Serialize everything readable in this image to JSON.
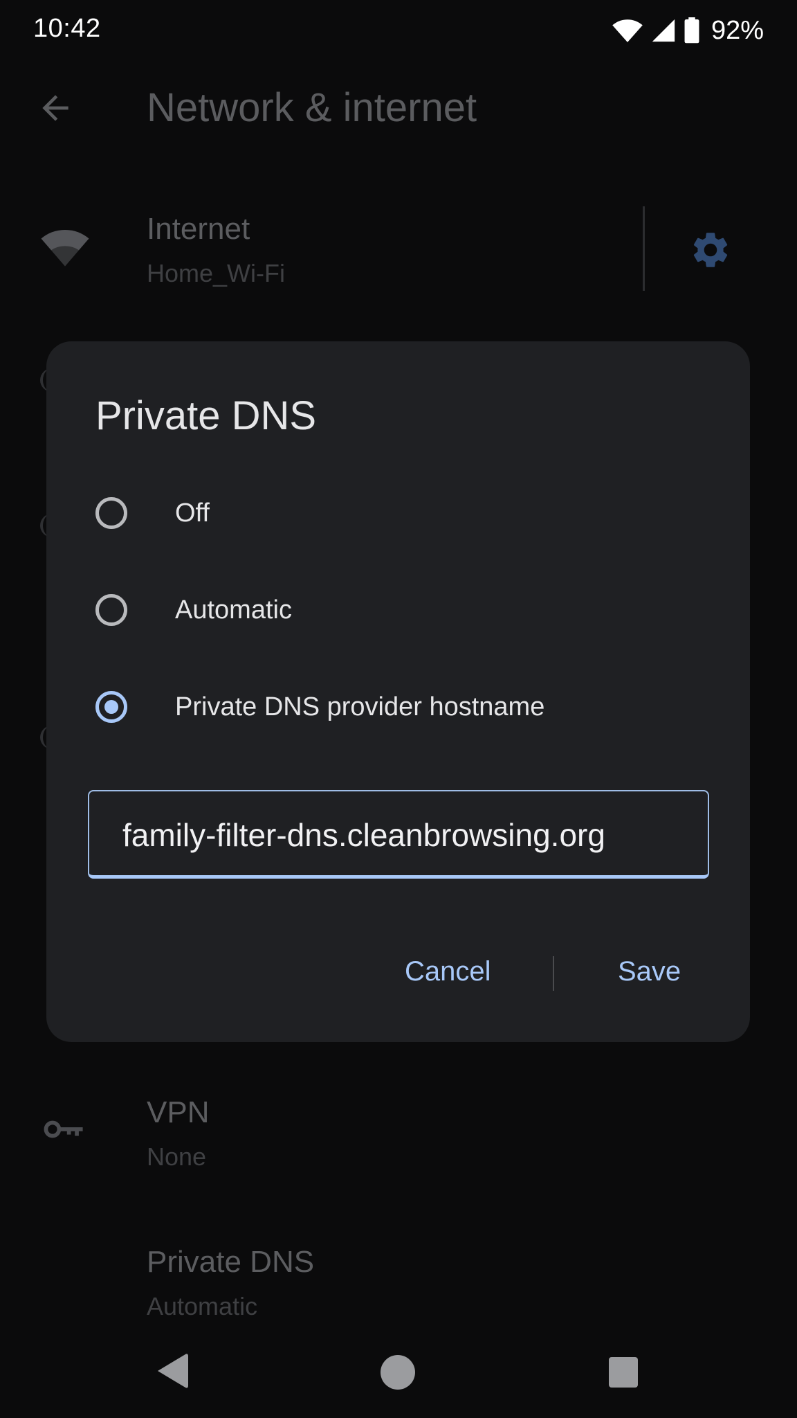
{
  "status_bar": {
    "time": "10:42",
    "battery_pct": "92%",
    "icons": [
      "wifi-icon",
      "cell-signal-icon",
      "battery-icon"
    ]
  },
  "background": {
    "title": "Network & internet",
    "items": [
      {
        "title": "Internet",
        "subtitle": "Home_Wi-Fi",
        "icon": "wifi-icon"
      },
      {
        "title": "VPN",
        "subtitle": "None",
        "icon": "vpn-key-icon"
      },
      {
        "title": "Private DNS",
        "subtitle": "Automatic"
      }
    ]
  },
  "dialog": {
    "title": "Private DNS",
    "options": [
      {
        "label": "Off",
        "selected": false
      },
      {
        "label": "Automatic",
        "selected": false
      },
      {
        "label": "Private DNS provider hostname",
        "selected": true
      }
    ],
    "hostname_value": "family-filter-dns.cleanbrowsing.org",
    "cancel_label": "Cancel",
    "save_label": "Save"
  },
  "colors": {
    "accent": "#a8c8f8",
    "dialog_bg": "#1f2023",
    "screen_bg": "#0b0b0c"
  }
}
